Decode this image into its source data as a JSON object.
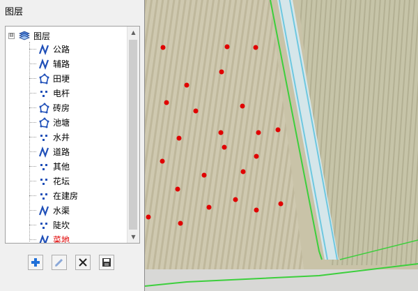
{
  "panel": {
    "title": "图层",
    "root_label": "图层",
    "root_expander": "⊟"
  },
  "layers": [
    {
      "label": "公路",
      "icon": "polyline-icon",
      "red": false
    },
    {
      "label": "辅路",
      "icon": "polyline-icon",
      "red": false
    },
    {
      "label": "田埂",
      "icon": "polygon-icon",
      "red": false
    },
    {
      "label": "电杆",
      "icon": "points-icon",
      "red": false
    },
    {
      "label": "砖房",
      "icon": "polygon-icon",
      "red": false
    },
    {
      "label": "池塘",
      "icon": "polygon-icon",
      "red": false
    },
    {
      "label": "水井",
      "icon": "points-icon",
      "red": false
    },
    {
      "label": "道路",
      "icon": "polyline-icon",
      "red": false
    },
    {
      "label": "其他",
      "icon": "points-icon",
      "red": false
    },
    {
      "label": "花坛",
      "icon": "points-icon",
      "red": false
    },
    {
      "label": "在建房",
      "icon": "points-icon",
      "red": false
    },
    {
      "label": "水渠",
      "icon": "polyline-icon",
      "red": false
    },
    {
      "label": "陡坎",
      "icon": "points-icon",
      "red": false
    },
    {
      "label": "菜地",
      "icon": "polyline-icon",
      "red": true
    }
  ],
  "toolbar": {
    "buttons": [
      {
        "name": "add-layer-button",
        "icon": "plus-icon"
      },
      {
        "name": "edit-layer-button",
        "icon": "pencil-icon"
      },
      {
        "name": "delete-layer-button",
        "icon": "x-icon"
      },
      {
        "name": "save-layer-button",
        "icon": "floppy-icon"
      }
    ]
  },
  "colors": {
    "point_marker": "#e00000",
    "boundary_line": "#3ccf3c",
    "water_channel": "#6ec8e0",
    "field": "#c8c2a8"
  }
}
